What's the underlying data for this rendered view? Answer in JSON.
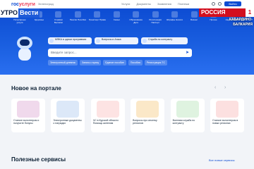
{
  "header": {
    "logo_left": "гос",
    "logo_right": "услуги",
    "region": "Зеленоград",
    "links": [
      "Услуги",
      "Документы",
      "Заявления",
      "Платежи"
    ],
    "login": "Войти"
  },
  "categories": [
    {
      "label": "Популярные услуги",
      "icon": "star-icon"
    },
    {
      "label": "Здоровье",
      "icon": "heart-icon"
    },
    {
      "label": "Справки Выписки",
      "icon": "document-icon"
    },
    {
      "label": "Пенсии Пособия",
      "icon": "wallet-icon"
    },
    {
      "label": "Транспорт Права",
      "icon": "car-icon"
    },
    {
      "label": "Семья",
      "icon": "family-icon"
    },
    {
      "label": "Образование Дети",
      "icon": "school-icon"
    },
    {
      "label": "Регистрация Паспорт",
      "icon": "passport-icon"
    },
    {
      "label": "Штрафы Налоги",
      "icon": "receipt-icon"
    },
    {
      "label": "Бизнес",
      "icon": "briefcase-icon"
    },
    {
      "label": "Прочее",
      "icon": "more-icon"
    },
    {
      "label": "Недвижимость",
      "icon": "house-icon"
    }
  ],
  "quick": [
    {
      "label": "МФКА в одном программах"
    },
    {
      "label": "Вопросы и Атака"
    },
    {
      "label": "Служба по контракту"
    }
  ],
  "search": {
    "placeholder": "Введите запрос..."
  },
  "chips": [
    "Электронный дневник",
    "Запись к врачу",
    "Единое пособие",
    "Пособия",
    "Регистрация ТС"
  ],
  "news": {
    "title": "Новое на портале",
    "cards": [
      {
        "caption": "Станьте волонтером и получите бонусы",
        "color": "#f0d9ec"
      },
      {
        "caption": "Электронные документы о наградах",
        "color": "#dce8f8"
      },
      {
        "caption": "ЧС в Курской области: Помощь жителям",
        "color": "#fde3e3"
      },
      {
        "caption": "Вопросы про ипотеку регионов",
        "color": "#fbe8c8"
      },
      {
        "caption": "Военная служба по контракту",
        "color": "#dff3e0"
      },
      {
        "caption": "Станьте волонтером в новых регионах",
        "color": "#fce0e0"
      }
    ]
  },
  "services": {
    "title": "Полезные сервисы",
    "all_link": "Все новые сервисы"
  },
  "overlays": {
    "tv_left_white": "УТРО",
    "tv_left_blue": "Вести",
    "channel": "РОССИЯ",
    "channel_num": "1",
    "region_line1": "КАБАРДИНО-",
    "region_line2": "БАЛКАРИЯ"
  }
}
